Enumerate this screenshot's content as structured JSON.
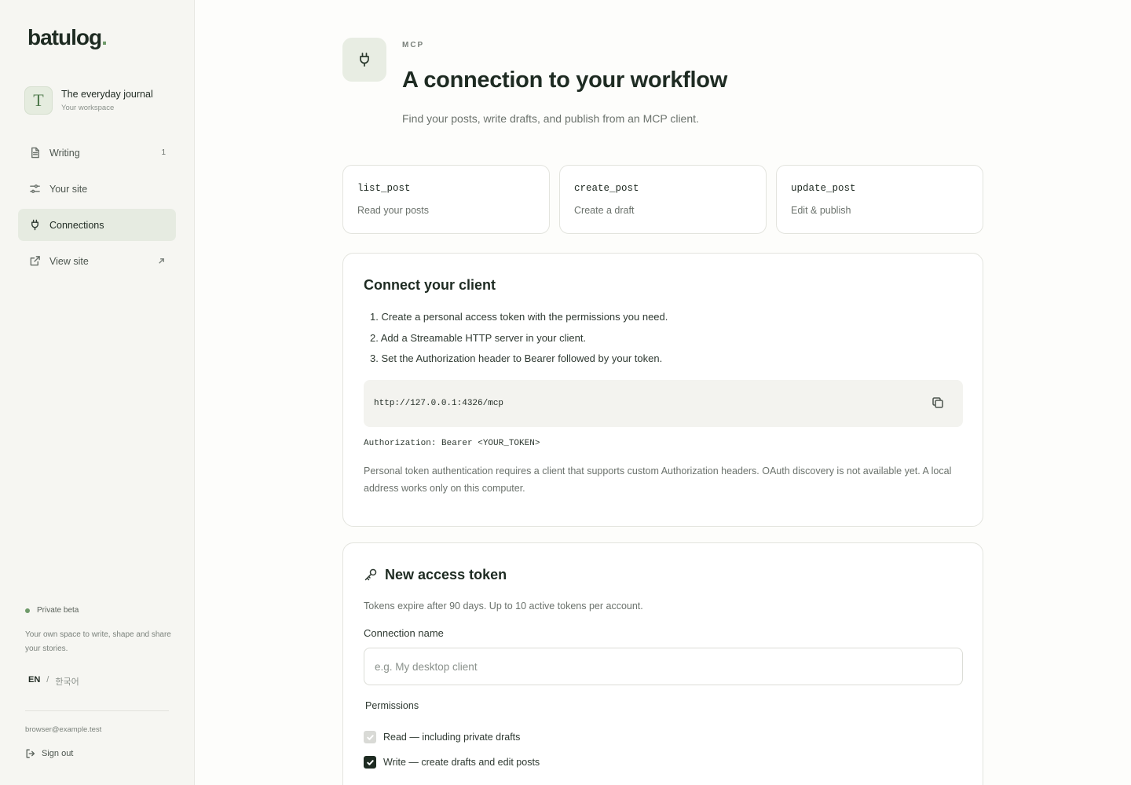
{
  "brand": {
    "name": "batulog",
    "dot": "."
  },
  "workspace": {
    "initial": "T",
    "name": "The everyday journal",
    "subtitle": "Your workspace"
  },
  "nav": [
    {
      "label": "Writing",
      "icon": "document-icon",
      "count": "1"
    },
    {
      "label": "Your site",
      "icon": "sliders-icon"
    },
    {
      "label": "Connections",
      "icon": "plug-icon",
      "active": true
    },
    {
      "label": "View site",
      "icon": "external-link-icon"
    }
  ],
  "sidebar_footer": {
    "beta": "Private beta",
    "tagline": "Your own space to write, shape and share your stories.",
    "lang_en": "EN",
    "lang_sep": "/",
    "lang_ko": "한국어",
    "email": "browser@example.test",
    "signout": "Sign out"
  },
  "header": {
    "eyebrow": "MCP",
    "title": "A connection to your workflow",
    "subtitle": "Find your posts, write drafts, and publish from an MCP client."
  },
  "tools": [
    {
      "name": "list_post",
      "desc": "Read your posts"
    },
    {
      "name": "create_post",
      "desc": "Create a draft"
    },
    {
      "name": "update_post",
      "desc": "Edit & publish"
    }
  ],
  "connect": {
    "title": "Connect your client",
    "steps": [
      "1. Create a personal access token with the permissions you need.",
      "2. Add a Streamable HTTP server in your client.",
      "3. Set the Authorization header to Bearer followed by your token."
    ],
    "endpoint": "http://127.0.0.1:4326/mcp",
    "auth_header": "Authorization: Bearer <YOUR_TOKEN>",
    "note": "Personal token authentication requires a client that supports custom Authorization headers. OAuth discovery is not available yet. A local address works only on this computer."
  },
  "token": {
    "title": "New access token",
    "subtitle": "Tokens expire after 90 days. Up to 10 active tokens per account.",
    "name_label": "Connection name",
    "name_placeholder": "e.g. My desktop client",
    "name_value": "",
    "permissions_label": "Permissions",
    "permissions": [
      {
        "label": "Read — including private drafts",
        "checked": true,
        "disabled": true
      },
      {
        "label": "Write — create drafts and edit posts",
        "checked": true,
        "disabled": false
      }
    ]
  },
  "colors": {
    "accent": "#6f9a6a",
    "ink": "#1e2b22",
    "active_bg": "#e6ebe1",
    "sidebar_bg": "#f6f6f2"
  }
}
